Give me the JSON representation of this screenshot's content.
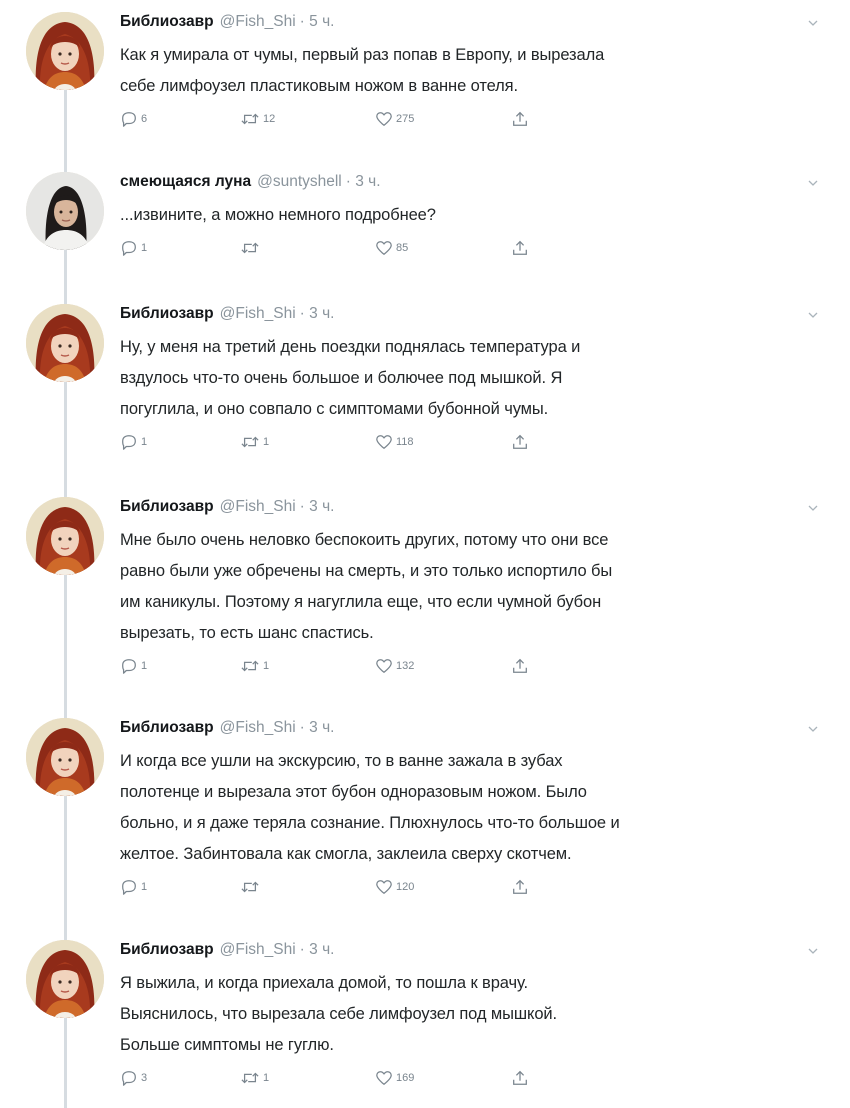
{
  "thread": {
    "tweets": [
      {
        "avatar": "red-haired-woman",
        "name": "Библиозавр",
        "handle": "@Fish_Shi",
        "time": "· 5 ч.",
        "text": "Как я умирала от чумы, первый раз попав в Европу, и вырезала\nсебе лимфоузел пластиковым ножом в ванне отеля.",
        "replies": "6",
        "retweets": "12",
        "likes": "275"
      },
      {
        "avatar": "dark-haired-woman",
        "name": "смеющаяся луна",
        "handle": "@suntyshell",
        "time": "· 3 ч.",
        "text": "...извините, а можно немного подробнее?",
        "replies": "1",
        "retweets": "",
        "likes": "85"
      },
      {
        "avatar": "red-haired-woman",
        "name": "Библиозавр",
        "handle": "@Fish_Shi",
        "time": "· 3 ч.",
        "text": "Ну, у меня на третий день поездки поднялась температура и\nвздулось что-то очень большое и болючее под мышкой. Я\nпогуглила, и оно совпало с симптомами бубонной чумы.",
        "replies": "1",
        "retweets": "1",
        "likes": "118"
      },
      {
        "avatar": "red-haired-woman",
        "name": "Библиозавр",
        "handle": "@Fish_Shi",
        "time": "· 3 ч.",
        "text": "Мне было очень неловко беспокоить других, потому что они все\nравно были уже обречены на смерть, и это только испортило бы\nим каникулы. Поэтому я нагуглила еще, что если чумной бубон\nвырезать, то есть шанс спастись.",
        "replies": "1",
        "retweets": "1",
        "likes": "132"
      },
      {
        "avatar": "red-haired-woman",
        "name": "Библиозавр",
        "handle": "@Fish_Shi",
        "time": "· 3 ч.",
        "text": "И когда все ушли на экскурсию, то в ванне зажала в зубах\nполотенце и вырезала этот бубон одноразовым ножом. Было\nбольно, и я даже теряла сознание. Плюхнулось что-то большое и\nжелтое. Забинтовала как смогла, заклеила сверху скотчем.",
        "replies": "1",
        "retweets": "",
        "likes": "120"
      },
      {
        "avatar": "red-haired-woman",
        "name": "Библиозавр",
        "handle": "@Fish_Shi",
        "time": "· 3 ч.",
        "text": "Я выжила, и когда приехала домой, то пошла к врачу.\nВыяснилось, что вырезала себе лимфоузел под мышкой.\nБольше симптомы не гуглю.",
        "replies": "3",
        "retweets": "1",
        "likes": "169"
      }
    ]
  },
  "colors": {
    "background": "#ffffff",
    "name": "#14171a",
    "meta": "#8a949c",
    "text": "#222628",
    "icon": "#7a858e",
    "thread_line": "#d6dce1"
  }
}
